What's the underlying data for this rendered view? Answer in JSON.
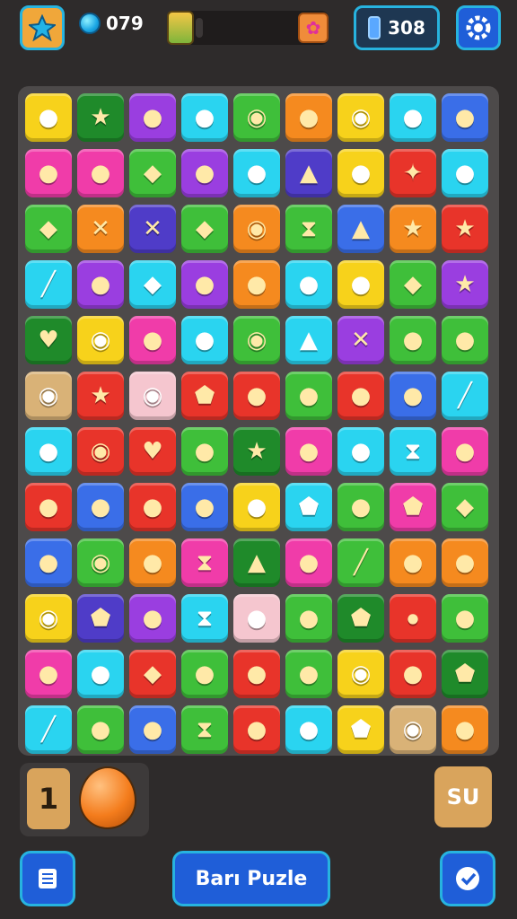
{
  "hud": {
    "gem_count": "079",
    "moves_count": "308",
    "level_progress": 0.0
  },
  "tray": {
    "count": "1"
  },
  "buttons": {
    "shuffle_label": "SU",
    "title_label": "Barı Puzle"
  },
  "colors": {
    "Y": "#f7d21b",
    "G": "#3fbf3a",
    "P": "#9a3ee0",
    "C": "#2ad4f0",
    "O": "#f58a1f",
    "M": "#f03ca9",
    "R": "#e8342a",
    "B": "#3a6ee8",
    "L": "#d9b277",
    "K": "#f5c6cf",
    "D": "#1f8a2a",
    "N": "#4f3cc8"
  },
  "candies": {
    "o": "●",
    "s": "★",
    "h": "◆",
    "c": "◉",
    "d": "⬟",
    "k": "✦",
    "x": "✕",
    "w": "⧗",
    "b": "⦁",
    "l": "╱",
    "a": "▲",
    "t": "♥"
  },
  "board": {
    "rows": [
      [
        "Y:o",
        "D:s",
        "P:o",
        "C:o",
        "G:c",
        "O:o",
        "Y:c",
        "C:o",
        "B:o"
      ],
      [
        "M:o",
        "M:o",
        "G:h",
        "P:o",
        "C:o",
        "N:a",
        "Y:o",
        "R:k",
        "C:o"
      ],
      [
        "G:h",
        "O:x",
        "N:x",
        "G:h",
        "O:c",
        "G:w",
        "B:a",
        "O:s",
        "R:s"
      ],
      [
        "C:l",
        "P:o",
        "C:h",
        "P:o",
        "O:o",
        "C:o",
        "Y:o",
        "G:h",
        "P:s"
      ],
      [
        "D:t",
        "Y:c",
        "M:o",
        "C:o",
        "G:c",
        "C:a",
        "P:x",
        "G:o",
        "G:o"
      ],
      [
        "L:c",
        "R:s",
        "K:c",
        "R:d",
        "R:o",
        "G:o",
        "R:o",
        "B:o",
        "C:l"
      ],
      [
        "C:o",
        "R:c",
        "R:t",
        "G:o",
        "D:s",
        "M:o",
        "C:o",
        "C:w",
        "M:o"
      ],
      [
        "R:o",
        "B:o",
        "R:o",
        "B:o",
        "Y:o",
        "C:d",
        "G:o",
        "M:d",
        "G:h"
      ],
      [
        "B:o",
        "G:c",
        "O:o",
        "M:w",
        "D:a",
        "M:o",
        "G:l",
        "O:o",
        "O:o"
      ],
      [
        "Y:c",
        "N:d",
        "P:o",
        "C:w",
        "K:o",
        "G:o",
        "D:d",
        "R:b",
        "G:o"
      ],
      [
        "M:o",
        "C:o",
        "R:h",
        "G:o",
        "R:o",
        "G:o",
        "Y:c",
        "R:o",
        "D:d"
      ],
      [
        "C:l",
        "G:o",
        "B:o",
        "G:w",
        "R:o",
        "C:o",
        "Y:d",
        "L:c",
        "O:o"
      ]
    ]
  }
}
